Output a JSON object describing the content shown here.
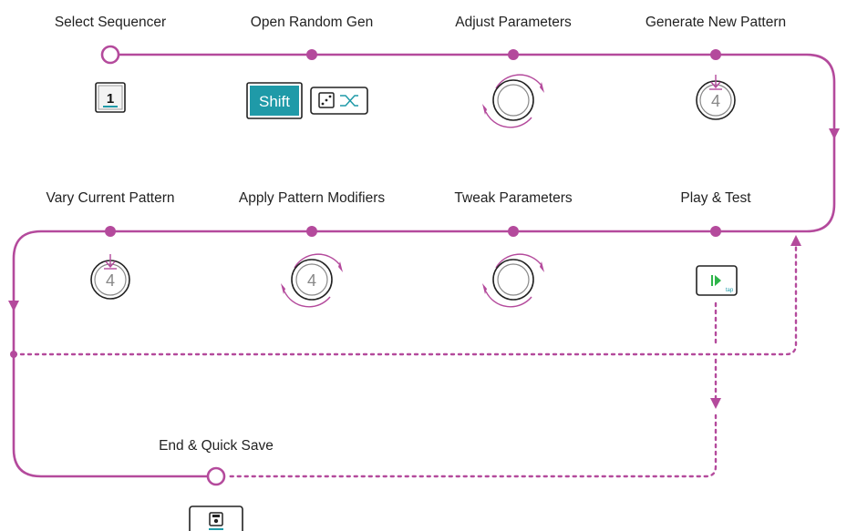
{
  "steps": [
    {
      "id": "select-sequencer",
      "label": "Select Sequencer"
    },
    {
      "id": "open-random-gen",
      "label": "Open Random Gen"
    },
    {
      "id": "adjust-parameters",
      "label": "Adjust Parameters"
    },
    {
      "id": "generate-new-pattern",
      "label": "Generate New Pattern"
    },
    {
      "id": "vary-current-pattern",
      "label": "Vary Current Pattern"
    },
    {
      "id": "apply-pattern-modifiers",
      "label": "Apply Pattern Modifiers"
    },
    {
      "id": "tweak-parameters",
      "label": "Tweak Parameters"
    },
    {
      "id": "play-test",
      "label": "Play & Test"
    },
    {
      "id": "end-quick-save",
      "label": "End & Quick Save"
    }
  ],
  "controls": {
    "sequencer_key": "1",
    "shift_key": "Shift",
    "encoder_number": "4",
    "tap_text": "tap"
  },
  "colors": {
    "flow": "#b44a9c",
    "shift_key_bg": "#1f9aa8",
    "play_green": "#2fb54a",
    "underline_teal": "#1f9aa8"
  }
}
